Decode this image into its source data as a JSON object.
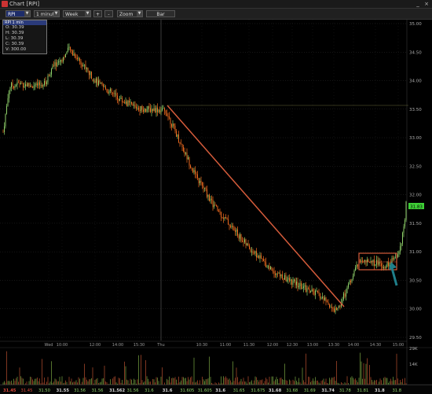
{
  "window": {
    "title": "Chart [RPI]",
    "close_glyph": "×",
    "minimize_glyph": "_"
  },
  "toolbar": {
    "symbol": "RPI",
    "interval": "1 minute",
    "range": "Week",
    "zoom_in": "+",
    "zoom_out": "-",
    "zoom": "Zoom",
    "chart_type": "Bar"
  },
  "ohlc_box": {
    "header": "RPI 1 min",
    "open": "O: 30.39",
    "high": "H: 30.39",
    "low": "L: 30.39",
    "close": "C: 30.39",
    "volume": "V: 300.00"
  },
  "chart_data": {
    "type": "candlestick",
    "y_ticks": [
      "35.00",
      "34.50",
      "34.00",
      "33.50",
      "33.00",
      "32.50",
      "32.00",
      "31.50",
      "31.00",
      "30.50",
      "30.00",
      "29.50"
    ],
    "ylim": [
      29.3,
      35.1
    ],
    "last_price": "31.83",
    "x_ticks": [
      "Wed",
      "10:00",
      "12:00",
      "14:00",
      "15:30",
      "Thu",
      "10:30",
      "11:00",
      "11:30",
      "12:00",
      "12:30",
      "13:00",
      "13:30",
      "14:00",
      "14:30",
      "15:00"
    ],
    "volume_ticks": [
      "29K",
      "14K"
    ],
    "footer_values": [
      "31.45",
      "31.45",
      "31.50",
      "31.55",
      "31.56",
      "31.56",
      "31.562",
      "31.56",
      "31.6",
      "31.6",
      "31.605",
      "31.605",
      "31.6",
      "31.65",
      "31.675",
      "31.68",
      "31.68",
      "31.69",
      "31.74",
      "31.78",
      "31.81",
      "31.8",
      "31.8"
    ],
    "colors": {
      "up": "#8fd16a",
      "down": "#ef6b1f",
      "trendline": "#d65c3b",
      "arrow": "#1f7f8a"
    }
  }
}
